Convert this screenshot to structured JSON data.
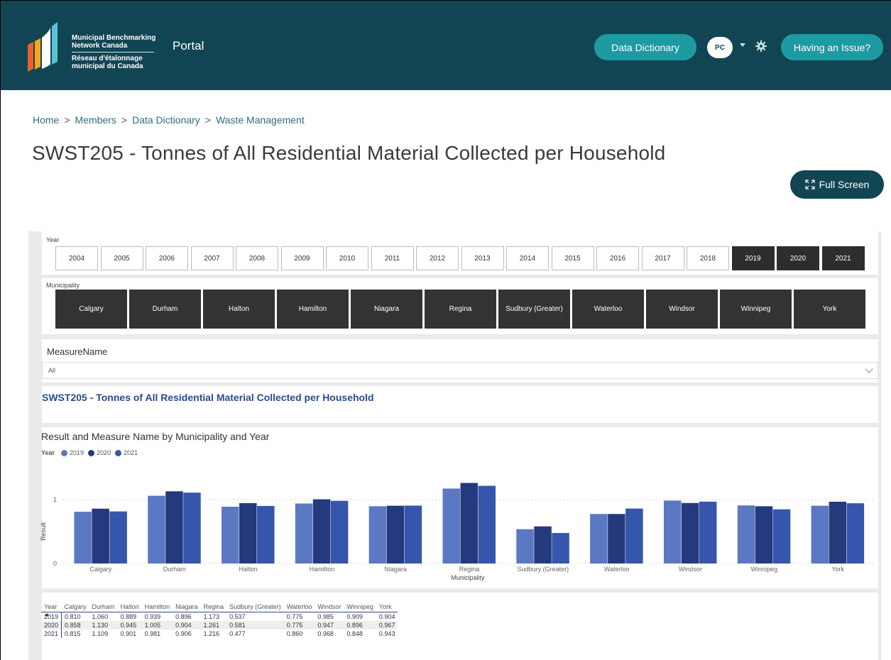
{
  "header": {
    "logo_lines": [
      "Municipal Benchmarking",
      "Network Canada",
      "Réseau d'étalonnage",
      "municipal du Canada"
    ],
    "portal_label": "Portal",
    "data_dictionary_label": "Data Dictionary",
    "avatar_initials": "PC",
    "issue_label": "Having an Issue?",
    "brand_color": "#124554",
    "accent_color": "#1e9aa3"
  },
  "breadcrumb": {
    "items": [
      "Home",
      "Members",
      "Data Dictionary",
      "Waste Management"
    ],
    "separator": ">"
  },
  "page_title": "SWST205 - Tonnes of All Residential Material Collected per Household",
  "fullscreen_label": "Full Screen",
  "year_slicer": {
    "label": "Year",
    "years": [
      "2004",
      "2005",
      "2006",
      "2007",
      "2008",
      "2009",
      "2010",
      "2011",
      "2012",
      "2013",
      "2014",
      "2015",
      "2016",
      "2017",
      "2018",
      "2019",
      "2020",
      "2021"
    ],
    "selected": [
      "2019",
      "2020",
      "2021"
    ]
  },
  "municipality_slicer": {
    "label": "Municipality",
    "items": [
      "Calgary",
      "Durham",
      "Halton",
      "Hamilton",
      "Niagara",
      "Regina",
      "Sudbury (Greater)",
      "Waterloo",
      "Windsor",
      "Winnipeg",
      "York"
    ]
  },
  "measure": {
    "label": "MeasureName",
    "value": "All"
  },
  "report_subtitle": "SWST205 - Tonnes of All Residential Material Collected per Household",
  "chart_data": {
    "type": "bar",
    "title": "Result and Measure Name by Municipality and Year",
    "xlabel": "Municipality",
    "ylabel": "Result",
    "legend_title": "Year",
    "yticks": [
      "0",
      "1"
    ],
    "ylim": [
      0,
      1.35
    ],
    "categories": [
      "Calgary",
      "Durham",
      "Halton",
      "Hamilton",
      "Niagara",
      "Regina",
      "Sudbury (Greater)",
      "Waterloo",
      "Windsor",
      "Winnipeg",
      "York"
    ],
    "series": [
      {
        "name": "2019",
        "color": "#5b78c2",
        "values": [
          0.81,
          1.06,
          0.889,
          0.939,
          0.896,
          1.173,
          0.537,
          0.775,
          0.985,
          0.909,
          0.904
        ]
      },
      {
        "name": "2020",
        "color": "#243a7c",
        "values": [
          0.858,
          1.13,
          0.945,
          1.005,
          0.904,
          1.261,
          0.581,
          0.775,
          0.947,
          0.896,
          0.967
        ]
      },
      {
        "name": "2021",
        "color": "#3556ac",
        "values": [
          0.815,
          1.109,
          0.901,
          0.981,
          0.906,
          1.216,
          0.477,
          0.86,
          0.968,
          0.848,
          0.943
        ]
      }
    ]
  },
  "table": {
    "headers": [
      "Year",
      "Calgary",
      "Durham",
      "Halton",
      "Hamilton",
      "Niagara",
      "Regina",
      "Sudbury (Greater)",
      "Waterloo",
      "Windsor",
      "Winnipeg",
      "York"
    ],
    "rows": [
      [
        "2019",
        "0.810",
        "1.060",
        "0.889",
        "0.939",
        "0.896",
        "1.173",
        "0.537",
        "0.775",
        "0.985",
        "0.909",
        "0.904"
      ],
      [
        "2020",
        "0.858",
        "1.130",
        "0.945",
        "1.005",
        "0.904",
        "1.261",
        "0.581",
        "0.775",
        "0.947",
        "0.896",
        "0.967"
      ],
      [
        "2021",
        "0.815",
        "1.109",
        "0.901",
        "0.981",
        "0.906",
        "1.216",
        "0.477",
        "0.860",
        "0.968",
        "0.848",
        "0.943"
      ]
    ]
  }
}
